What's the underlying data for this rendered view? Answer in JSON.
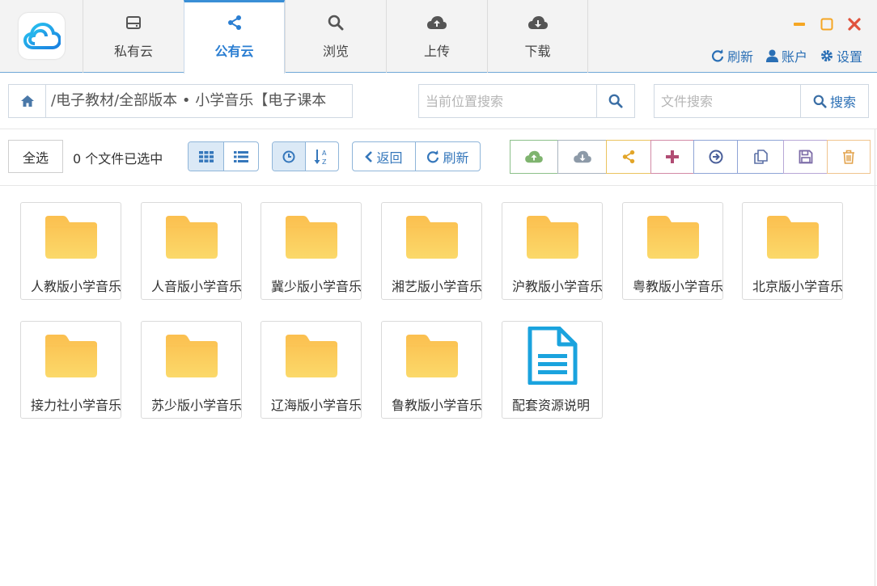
{
  "tabs": [
    {
      "label": "私有云",
      "icon": "hard-drive-icon",
      "active": false
    },
    {
      "label": "公有云",
      "icon": "share-icon",
      "active": true
    },
    {
      "label": "浏览",
      "icon": "search-icon",
      "active": false
    },
    {
      "label": "上传",
      "icon": "cloud-upload-icon",
      "active": false
    },
    {
      "label": "下载",
      "icon": "cloud-download-icon",
      "active": false
    }
  ],
  "top_links": {
    "refresh": "刷新",
    "account": "账户",
    "settings": "设置"
  },
  "path": {
    "text": "/电子教材/全部版本 • 小学音乐【电子课本"
  },
  "location_search": {
    "placeholder": "当前位置搜索"
  },
  "file_search": {
    "placeholder": "文件搜索",
    "button": "搜索"
  },
  "toolbar": {
    "select_all": "全选",
    "selected_count": "0 个文件已选中",
    "back": "返回",
    "refresh": "刷新"
  },
  "files": [
    {
      "name": "人教版小学音乐",
      "type": "folder"
    },
    {
      "name": "人音版小学音乐",
      "type": "folder"
    },
    {
      "name": "冀少版小学音乐",
      "type": "folder"
    },
    {
      "name": "湘艺版小学音乐",
      "type": "folder"
    },
    {
      "name": "沪教版小学音乐",
      "type": "folder"
    },
    {
      "name": "粤教版小学音乐",
      "type": "folder"
    },
    {
      "name": "北京版小学音乐",
      "type": "folder"
    },
    {
      "name": "接力社小学音乐",
      "type": "folder"
    },
    {
      "name": "苏少版小学音乐",
      "type": "folder"
    },
    {
      "name": "辽海版小学音乐",
      "type": "folder"
    },
    {
      "name": "鲁教版小学音乐",
      "type": "folder"
    },
    {
      "name": "配套资源说明",
      "type": "document"
    }
  ],
  "colors": {
    "accent": "#2a7ed2",
    "folder_top": "#fbbf4f",
    "folder_bottom": "#fbd96a",
    "doc": "#1aa3de",
    "act_upload": "#7fb46f",
    "act_download": "#8d9aa8",
    "act_share": "#e2a529",
    "act_new": "#b14d74",
    "act_move": "#5a6fb2",
    "act_copy": "#5a6fa5",
    "act_save": "#7b6aa6",
    "act_delete": "#e2a24b"
  }
}
